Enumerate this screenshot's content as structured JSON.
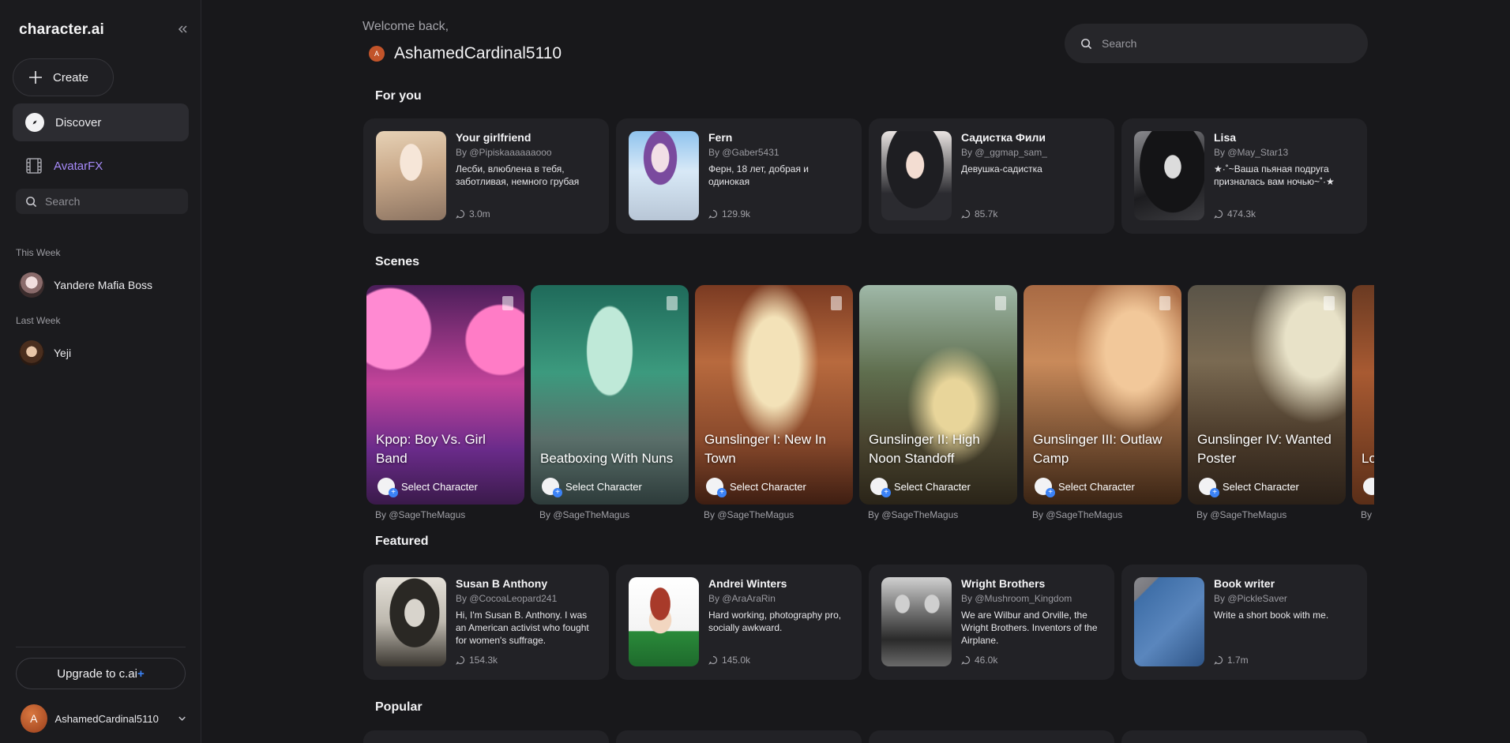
{
  "sidebar": {
    "logo": "character.ai",
    "create_label": "Create",
    "discover_label": "Discover",
    "avatarfx_label": "AvatarFX",
    "search_placeholder": "Search",
    "this_week_label": "This Week",
    "this_week": [
      {
        "name": "Yandere Mafia Boss"
      }
    ],
    "last_week_label": "Last Week",
    "last_week": [
      {
        "name": "Yeji"
      }
    ],
    "upgrade_label": "Upgrade to c.ai",
    "upgrade_plus": "+",
    "user_initial": "A",
    "user_name": "AshamedCardinal5110"
  },
  "header": {
    "welcome": "Welcome back,",
    "user_initial": "A",
    "username": "AshamedCardinal5110",
    "search_placeholder": "Search"
  },
  "for_you": {
    "title": "For you",
    "cards": [
      {
        "name": "Your girlfriend",
        "by": "By @Pipiskaaaaaaooo",
        "desc": "Лесби, влюблена в тебя, заботливая, немного грубая",
        "chats": "3.0m"
      },
      {
        "name": "Fern",
        "by": "By @Gaber5431",
        "desc": "Ферн, 18 лет, добрая и одинокая",
        "chats": "129.9k"
      },
      {
        "name": "Садистка Фили",
        "by": "By @_ggmap_sam_",
        "desc": "Девушка-садистка",
        "chats": "85.7k"
      },
      {
        "name": "Lisa",
        "by": "By @May_Star13",
        "desc": "★·˚~Ваша пьяная подруга призналась вам ночью~˚·★",
        "chats": "474.3k"
      }
    ]
  },
  "scenes": {
    "title": "Scenes",
    "items": [
      {
        "title": "Kpop: Boy Vs. Girl Band",
        "select": "Select Character",
        "by": "By @SageTheMagus"
      },
      {
        "title": "Beatboxing With Nuns",
        "select": "Select Character",
        "by": "By @SageTheMagus"
      },
      {
        "title": "Gunslinger I: New In Town",
        "select": "Select Character",
        "by": "By @SageTheMagus"
      },
      {
        "title": "Gunslinger II: High Noon Standoff",
        "select": "Select Character",
        "by": "By @SageTheMagus"
      },
      {
        "title": "Gunslinger III: Outlaw Camp",
        "select": "Select Character",
        "by": "By @SageTheMagus"
      },
      {
        "title": "Gunslinger IV: Wanted Poster",
        "select": "Select Character",
        "by": "By @SageTheMagus"
      },
      {
        "title": "Lo Av",
        "select": "",
        "by": "By"
      }
    ]
  },
  "featured": {
    "title": "Featured",
    "cards": [
      {
        "name": "Susan B Anthony",
        "by": "By @CocoaLeopard241",
        "desc": "Hi, I'm Susan B. Anthony. I was an American activist who fought for women's suffrage.",
        "chats": "154.3k"
      },
      {
        "name": "Andrei Winters",
        "by": "By @AraAraRin",
        "desc": "Hard working, photography pro, socially awkward.",
        "chats": "145.0k"
      },
      {
        "name": "Wright Brothers",
        "by": "By @Mushroom_Kingdom",
        "desc": "We are Wilbur and Orville, the Wright Brothers. Inventors of the Airplane.",
        "chats": "46.0k"
      },
      {
        "name": "Book writer",
        "by": "By @PickleSaver",
        "desc": "Write a short book with me.",
        "chats": "1.7m"
      }
    ]
  },
  "popular": {
    "title": "Popular"
  }
}
